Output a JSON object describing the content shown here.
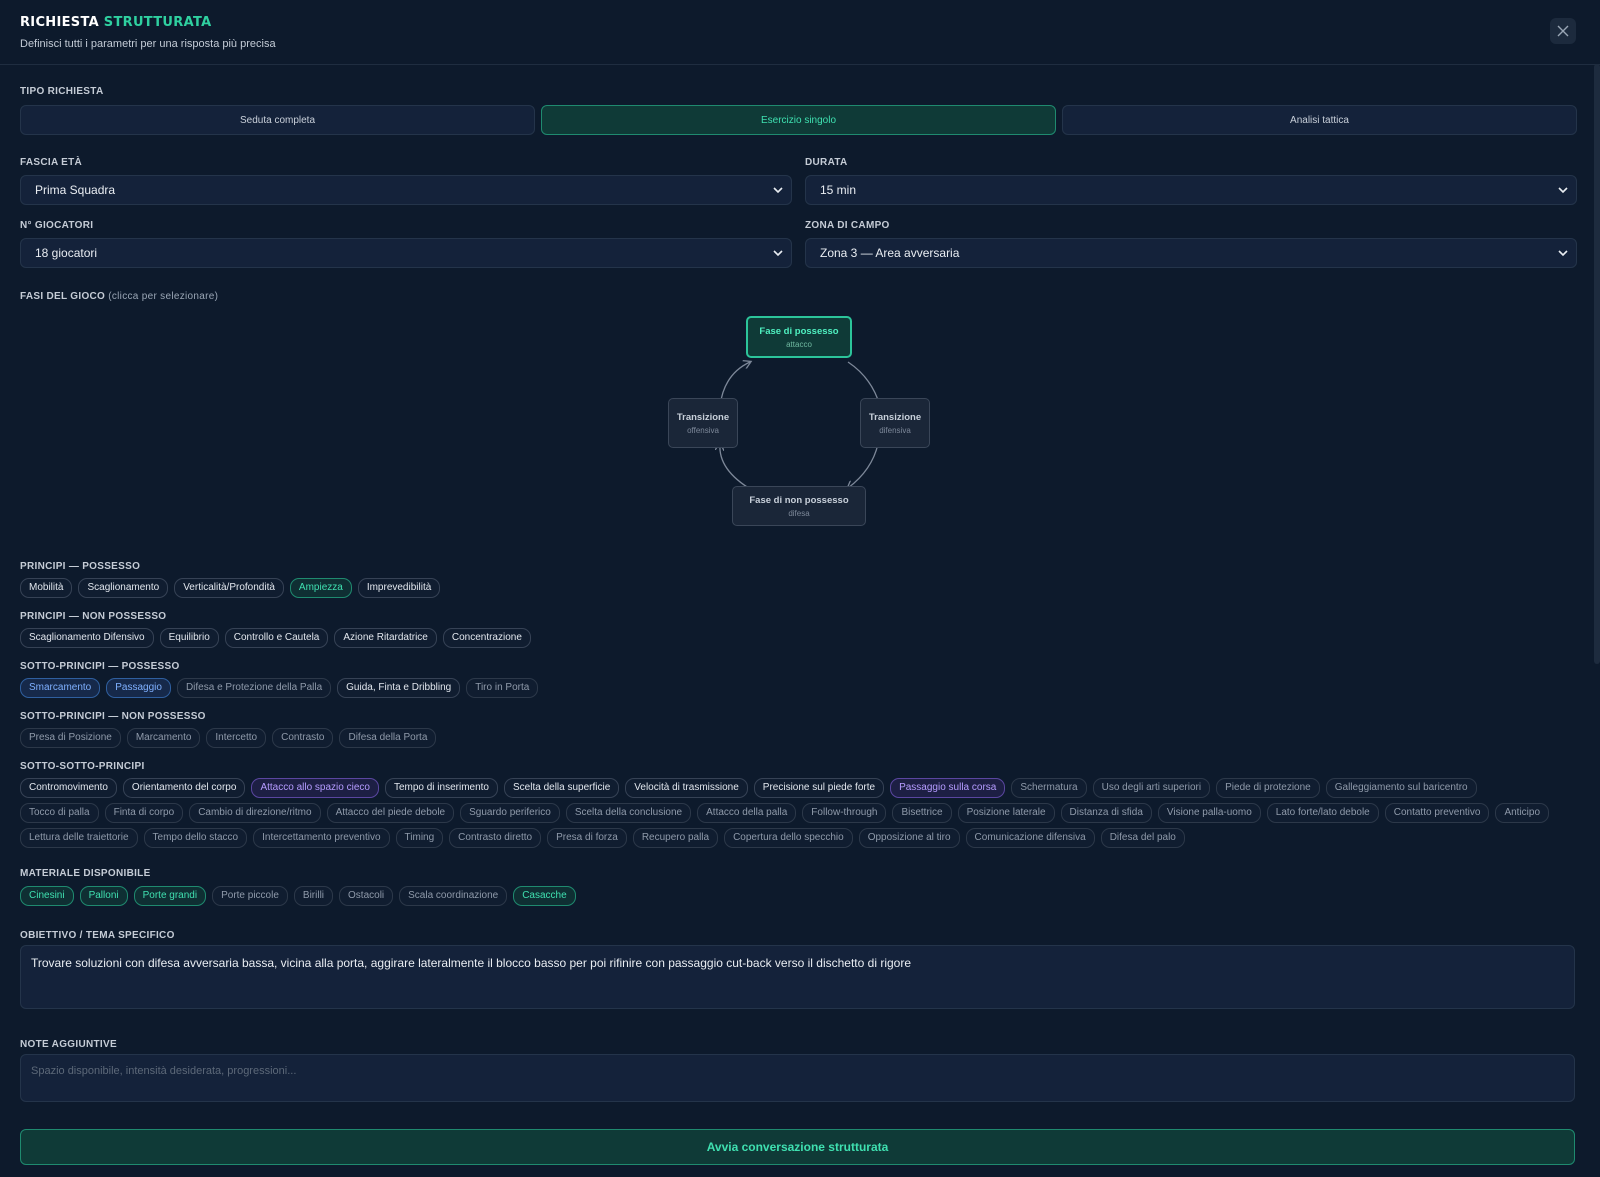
{
  "header": {
    "title_main": "RICHIESTA",
    "title_accent": "STRUTTURATA",
    "subtitle": "Definisci tutti i parametri per una risposta più precisa"
  },
  "sections": {
    "tipo": "TIPO RICHIESTA",
    "fascia": "FASCIA ETÀ",
    "durata": "DURATA",
    "giocatori": "N° GIOCATORI",
    "zona": "ZONA DI CAMPO",
    "fasi": "FASI DEL GIOCO",
    "fasi_hint": "(clicca per selezionare)",
    "principi_pos": "PRINCIPI — POSSESSO",
    "principi_nonpos": "PRINCIPI — NON POSSESSO",
    "sotto_pos": "SOTTO-PRINCIPI — POSSESSO",
    "sotto_nonpos": "SOTTO-PRINCIPI — NON POSSESSO",
    "sotto_sotto": "SOTTO-SOTTO-PRINCIPI",
    "materiale": "MATERIALE DISPONIBILE",
    "obiettivo": "OBIETTIVO / TEMA SPECIFICO",
    "note": "NOTE AGGIUNTIVE"
  },
  "tipo_richiesta": [
    {
      "label": "Seduta completa",
      "active": false
    },
    {
      "label": "Esercizio singolo",
      "active": true
    },
    {
      "label": "Analisi tattica",
      "active": false
    }
  ],
  "selects": {
    "fascia": "Prima Squadra",
    "durata": "15 min",
    "giocatori": "18 giocatori",
    "zona": "Zona 3 — Area avversaria"
  },
  "fasi": {
    "possesso": {
      "title": "Fase di possesso",
      "sub": "attacco"
    },
    "trans_off": {
      "title": "Transizione",
      "sub": "offensiva"
    },
    "trans_dif": {
      "title": "Transizione",
      "sub": "difensiva"
    },
    "non_possesso": {
      "title": "Fase di non possesso",
      "sub": "difesa"
    }
  },
  "chip_groups": {
    "principi_pos": [
      {
        "label": "Mobilità",
        "state": "normal"
      },
      {
        "label": "Scaglionamento",
        "state": "normal"
      },
      {
        "label": "Verticalità/Profondità",
        "state": "normal"
      },
      {
        "label": "Ampiezza",
        "state": "green"
      },
      {
        "label": "Imprevedibilità",
        "state": "normal"
      }
    ],
    "principi_nonpos": [
      {
        "label": "Scaglionamento Difensivo",
        "state": "normal"
      },
      {
        "label": "Equilibrio",
        "state": "normal"
      },
      {
        "label": "Controllo e Cautela",
        "state": "normal"
      },
      {
        "label": "Azione Ritardatrice",
        "state": "normal"
      },
      {
        "label": "Concentrazione",
        "state": "normal"
      }
    ],
    "sotto_pos": [
      {
        "label": "Smarcamento",
        "state": "blue"
      },
      {
        "label": "Passaggio",
        "state": "blue"
      },
      {
        "label": "Difesa e Protezione della Palla",
        "state": "dim"
      },
      {
        "label": "Guida, Finta e Dribbling",
        "state": "normal"
      },
      {
        "label": "Tiro in Porta",
        "state": "dim"
      }
    ],
    "sotto_nonpos": [
      {
        "label": "Presa di Posizione",
        "state": "dim"
      },
      {
        "label": "Marcamento",
        "state": "dim"
      },
      {
        "label": "Intercetto",
        "state": "dim"
      },
      {
        "label": "Contrasto",
        "state": "dim"
      },
      {
        "label": "Difesa della Porta",
        "state": "dim"
      }
    ],
    "sotto_sotto": [
      {
        "label": "Contromovimento",
        "state": "normal"
      },
      {
        "label": "Orientamento del corpo",
        "state": "normal"
      },
      {
        "label": "Attacco allo spazio cieco",
        "state": "purple"
      },
      {
        "label": "Tempo di inserimento",
        "state": "normal"
      },
      {
        "label": "Scelta della superficie",
        "state": "normal"
      },
      {
        "label": "Velocità di trasmissione",
        "state": "normal"
      },
      {
        "label": "Precisione sul piede forte",
        "state": "normal"
      },
      {
        "label": "Passaggio sulla corsa",
        "state": "purple"
      },
      {
        "label": "Schermatura",
        "state": "dim"
      },
      {
        "label": "Uso degli arti superiori",
        "state": "dim"
      },
      {
        "label": "Piede di protezione",
        "state": "dim"
      },
      {
        "label": "Galleggiamento sul baricentro",
        "state": "dim"
      },
      {
        "label": "Tocco di palla",
        "state": "dim"
      },
      {
        "label": "Finta di corpo",
        "state": "dim"
      },
      {
        "label": "Cambio di direzione/ritmo",
        "state": "dim"
      },
      {
        "label": "Attacco del piede debole",
        "state": "dim"
      },
      {
        "label": "Sguardo periferico",
        "state": "dim"
      },
      {
        "label": "Scelta della conclusione",
        "state": "dim"
      },
      {
        "label": "Attacco della palla",
        "state": "dim"
      },
      {
        "label": "Follow-through",
        "state": "dim"
      },
      {
        "label": "Bisettrice",
        "state": "dim"
      },
      {
        "label": "Posizione laterale",
        "state": "dim"
      },
      {
        "label": "Distanza di sfida",
        "state": "dim"
      },
      {
        "label": "Visione palla-uomo",
        "state": "dim"
      },
      {
        "label": "Lato forte/lato debole",
        "state": "dim"
      },
      {
        "label": "Contatto preventivo",
        "state": "dim"
      },
      {
        "label": "Anticipo",
        "state": "dim"
      },
      {
        "label": "Lettura delle traiettorie",
        "state": "dim"
      },
      {
        "label": "Tempo dello stacco",
        "state": "dim"
      },
      {
        "label": "Intercettamento preventivo",
        "state": "dim"
      },
      {
        "label": "Timing",
        "state": "dim"
      },
      {
        "label": "Contrasto diretto",
        "state": "dim"
      },
      {
        "label": "Presa di forza",
        "state": "dim"
      },
      {
        "label": "Recupero palla",
        "state": "dim"
      },
      {
        "label": "Copertura dello specchio",
        "state": "dim"
      },
      {
        "label": "Opposizione al tiro",
        "state": "dim"
      },
      {
        "label": "Comunicazione difensiva",
        "state": "dim"
      },
      {
        "label": "Difesa del palo",
        "state": "dim"
      }
    ],
    "materiale": [
      {
        "label": "Cinesini",
        "state": "green"
      },
      {
        "label": "Palloni",
        "state": "green"
      },
      {
        "label": "Porte grandi",
        "state": "green"
      },
      {
        "label": "Porte piccole",
        "state": "dim"
      },
      {
        "label": "Birilli",
        "state": "dim"
      },
      {
        "label": "Ostacoli",
        "state": "dim"
      },
      {
        "label": "Scala coordinazione",
        "state": "dim"
      },
      {
        "label": "Casacche",
        "state": "green"
      }
    ]
  },
  "obiettivo_text": "Trovare soluzioni con difesa avversaria bassa, vicina alla porta, aggirare lateralmente il blocco basso per poi rifinire con passaggio cut-back verso il dischetto di rigore",
  "note_placeholder": "Spazio disponibile, intensità desiderata, progressioni...",
  "submit_label": "Avvia conversazione strutturata",
  "colors": {
    "accent": "#2fd0a0",
    "background": "#0d1a2c"
  }
}
